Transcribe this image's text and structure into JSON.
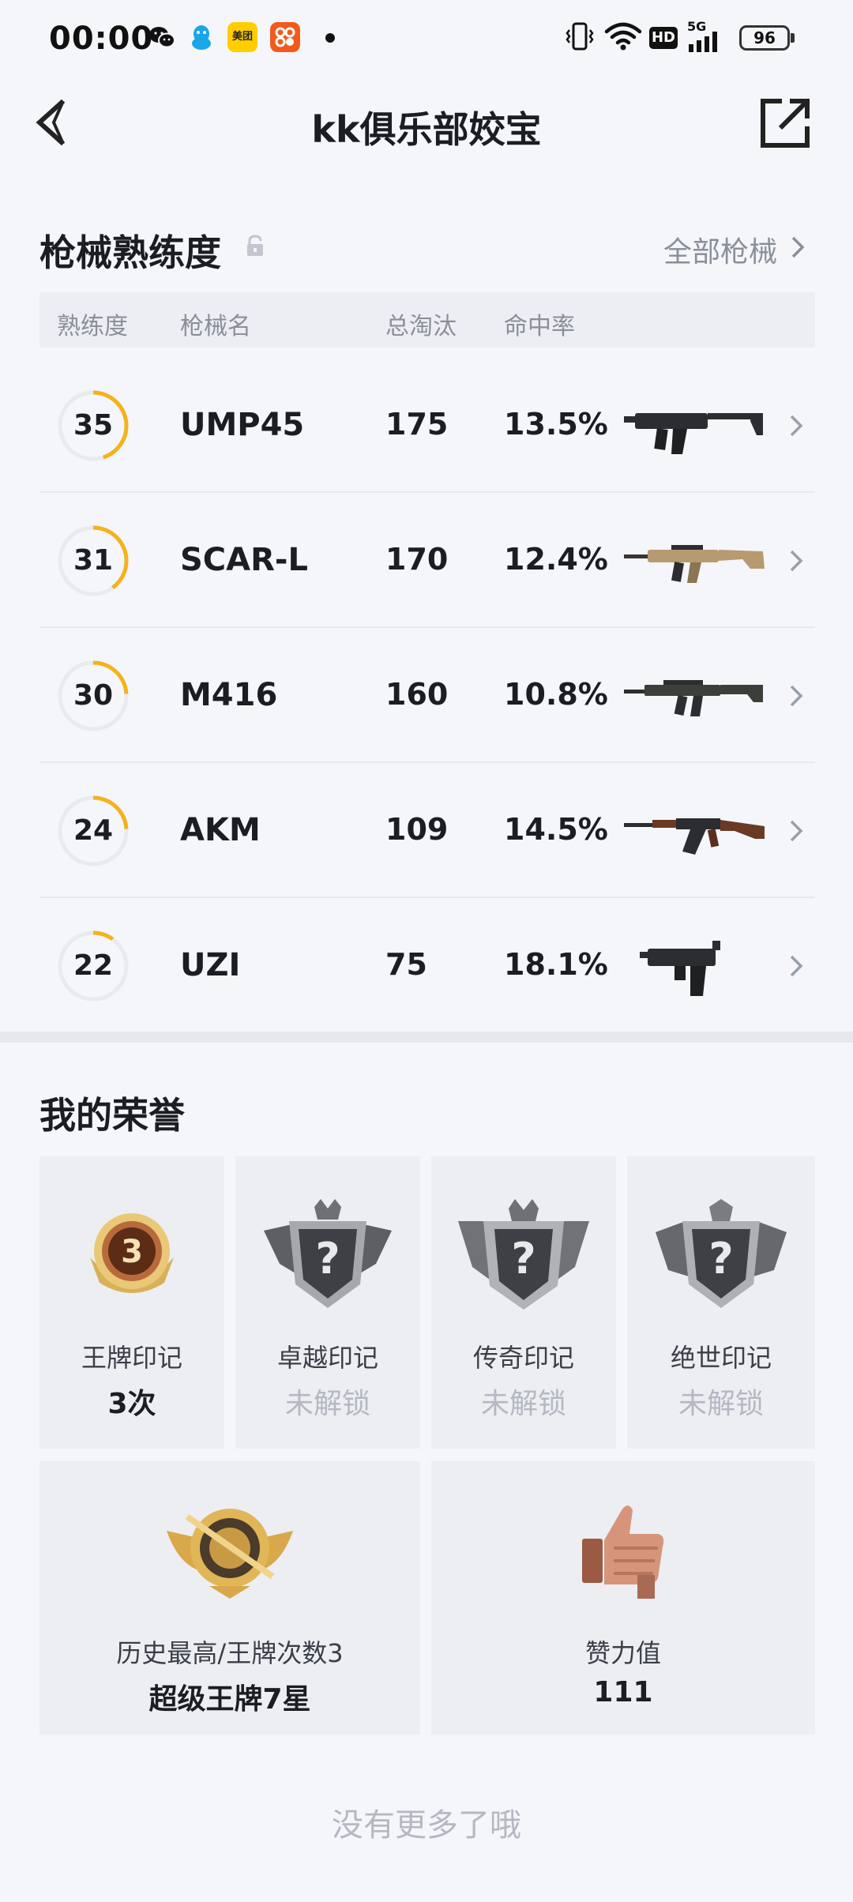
{
  "status_bar": {
    "time": "00:00",
    "app_icons": [
      "wechat-icon",
      "qq-icon",
      "meituan-icon",
      "taobao-icon"
    ],
    "meituan_text": "美团",
    "hd_label": "HD",
    "network_label": "5G",
    "battery": "96"
  },
  "header": {
    "title": "kk俱乐部姣宝"
  },
  "weapons": {
    "section_title": "枪械熟练度",
    "all_link": "全部枪械",
    "columns": [
      "熟练度",
      "枪械名",
      "总淘汰",
      "命中率"
    ],
    "accent_color": "#f5b21c",
    "rows": [
      {
        "level": "35",
        "level_progress": 0.45,
        "name": "UMP45",
        "kills": "175",
        "hit_rate": "13.5%"
      },
      {
        "level": "31",
        "level_progress": 0.4,
        "name": "SCAR-L",
        "kills": "170",
        "hit_rate": "12.4%"
      },
      {
        "level": "30",
        "level_progress": 0.24,
        "name": "M416",
        "kills": "160",
        "hit_rate": "10.8%"
      },
      {
        "level": "24",
        "level_progress": 0.24,
        "name": "AKM",
        "kills": "109",
        "hit_rate": "14.5%"
      },
      {
        "level": "22",
        "level_progress": 0.1,
        "name": "UZI",
        "kills": "75",
        "hit_rate": "18.1%"
      }
    ]
  },
  "honors": {
    "section_title": "我的荣誉",
    "marks": [
      {
        "label": "王牌印记",
        "value": "3次",
        "locked": false,
        "badge_text": "3"
      },
      {
        "label": "卓越印记",
        "value": "未解锁",
        "locked": true,
        "badge_text": "?"
      },
      {
        "label": "传奇印记",
        "value": "未解锁",
        "locked": true,
        "badge_text": "?"
      },
      {
        "label": "绝世印记",
        "value": "未解锁",
        "locked": true,
        "badge_text": "?"
      }
    ],
    "rank_card": {
      "label": "历史最高/王牌次数3",
      "value": "超级王牌7星"
    },
    "likes_card": {
      "label": "赞力值",
      "value": "111"
    }
  },
  "footer_text": "没有更多了哦"
}
